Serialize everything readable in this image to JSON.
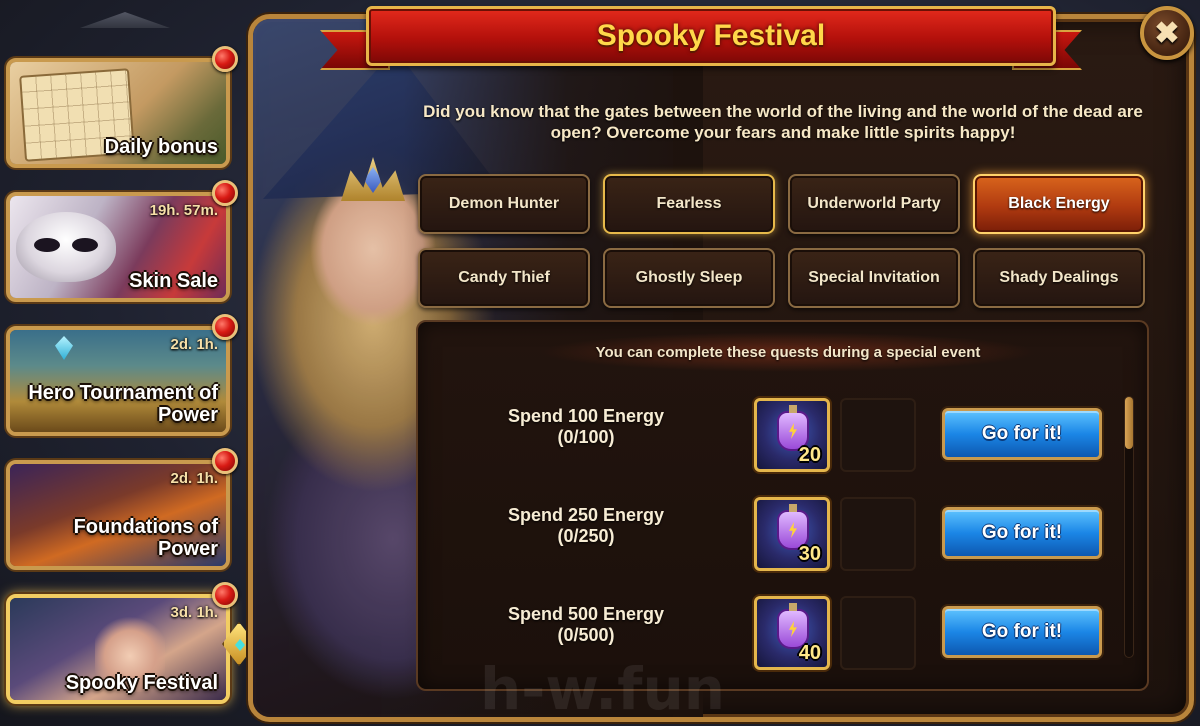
{
  "sidebar": {
    "events": [
      {
        "label": "Daily bonus",
        "timer": ""
      },
      {
        "label": "Skin Sale",
        "timer": "19h. 57m."
      },
      {
        "label": "Hero Tournament of Power",
        "timer": "2d. 1h."
      },
      {
        "label": "Foundations of Power",
        "timer": "2d. 1h."
      },
      {
        "label": "Spooky Festival",
        "timer": "3d. 1h."
      }
    ]
  },
  "panel": {
    "title": "Spooky Festival",
    "close_glyph": "✖",
    "intro": "Did you know that the gates between the world of the living and the world of the dead are open? Overcome your fears and make little spirits happy!",
    "tabs": [
      {
        "label": "Demon Hunter"
      },
      {
        "label": "Fearless"
      },
      {
        "label": "Underworld Party"
      },
      {
        "label": "Black Energy"
      },
      {
        "label": "Candy Thief"
      },
      {
        "label": "Ghostly Sleep"
      },
      {
        "label": "Special Invitation"
      },
      {
        "label": "Shady Dealings"
      }
    ],
    "active_tab": "Black Energy",
    "quest_header": "You can complete these quests during a special event",
    "quests": [
      {
        "title": "Spend 100 Energy",
        "progress": "(0/100)",
        "reward_count": "20",
        "button": "Go for it!"
      },
      {
        "title": "Spend 250 Energy",
        "progress": "(0/250)",
        "reward_count": "30",
        "button": "Go for it!"
      },
      {
        "title": "Spend 500 Energy",
        "progress": "(0/500)",
        "reward_count": "40",
        "button": "Go for it!"
      }
    ]
  },
  "watermark": "h-w.fun",
  "icons": {
    "close": "close-icon",
    "notification": "red-notification-dot",
    "reward": "energy-potion-icon",
    "selected": "diamond-marker-icon"
  },
  "colors": {
    "title_text": "#ffd84a",
    "banner_red": "#b3100b",
    "frame_gold": "#b9853b",
    "active_tab": "#d9651c",
    "go_button_blue": "#1b86e6"
  }
}
